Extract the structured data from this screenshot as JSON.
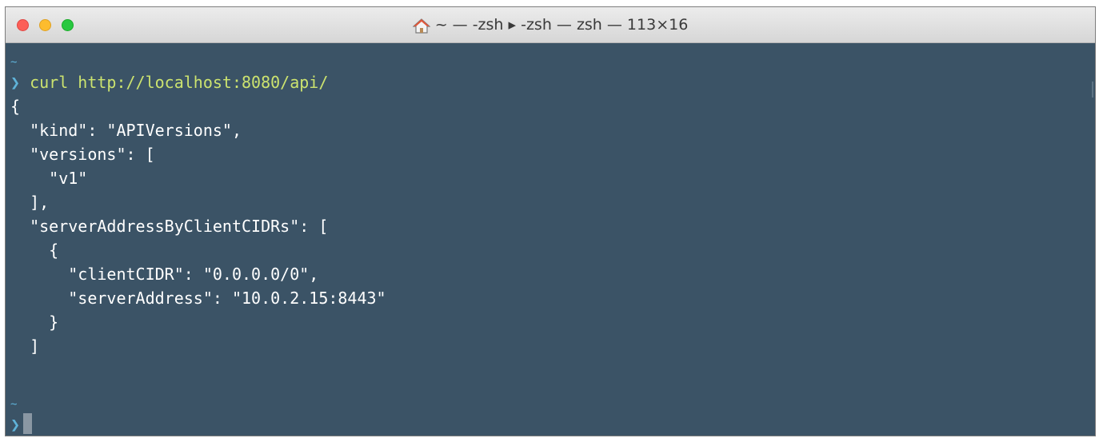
{
  "window": {
    "title": "~ — -zsh ▸ -zsh — zsh — 113×16"
  },
  "terminal": {
    "prompt_tilde": "~",
    "prompt_symbol": "❯",
    "command": "curl http://localhost:8080/api/",
    "output_lines": [
      "{",
      "  \"kind\": \"APIVersions\",",
      "  \"versions\": [",
      "    \"v1\"",
      "  ],",
      "  \"serverAddressByClientCIDRs\": [",
      "    {",
      "      \"clientCIDR\": \"0.0.0.0/0\",",
      "      \"serverAddress\": \"10.0.2.15:8443\"",
      "    }",
      "  ]"
    ]
  },
  "colors": {
    "background": "#3b5366",
    "prompt": "#5fb3d9",
    "command": "#cce36f",
    "text": "#ffffff"
  }
}
